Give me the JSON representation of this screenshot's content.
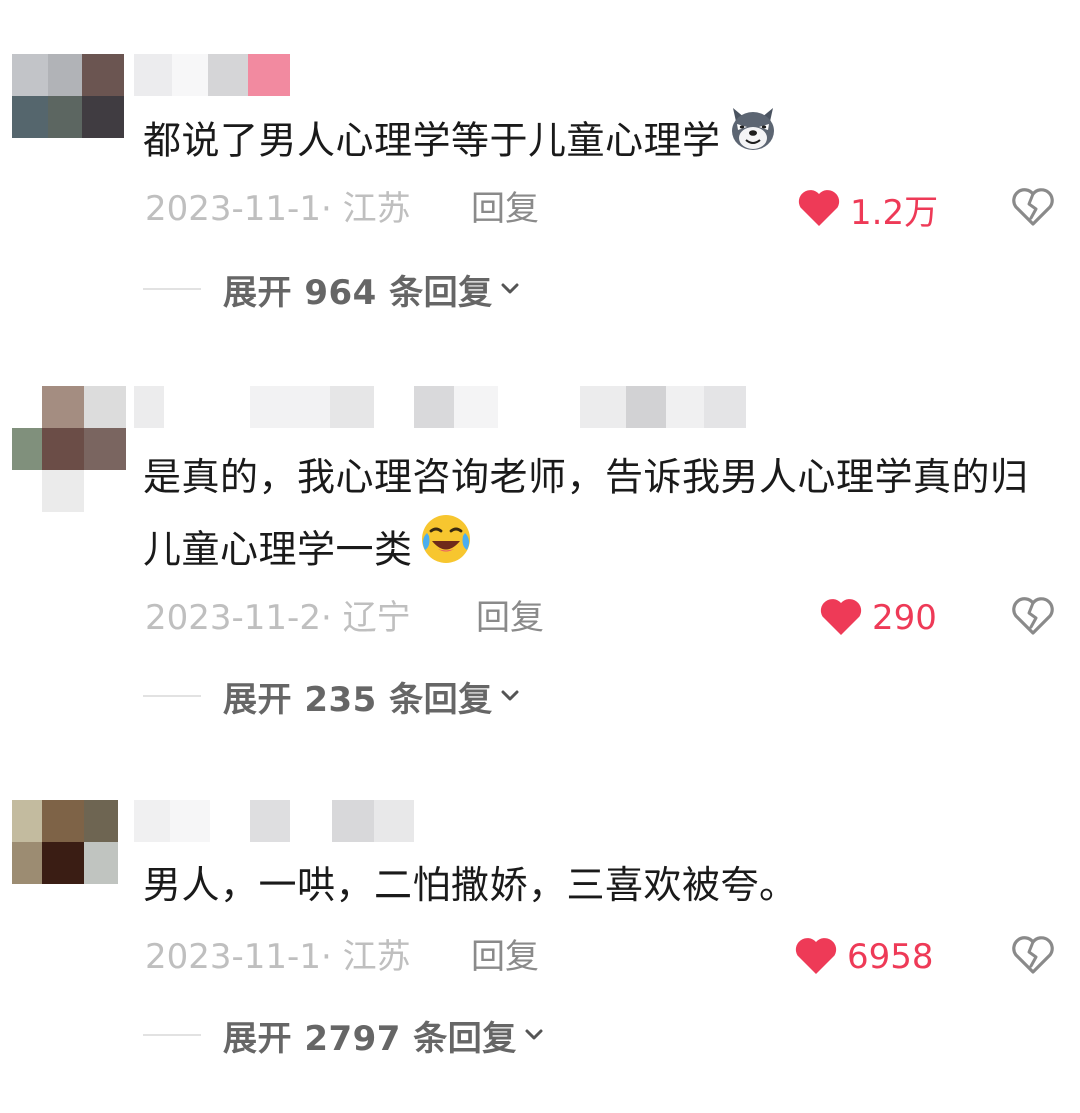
{
  "colors": {
    "heart": "#ee3a57",
    "like_count": "#ee3a57",
    "meta_text": "#bfbfbf",
    "reply_text": "#8a8a8a",
    "expand_text": "#666666"
  },
  "comments": [
    {
      "text": "都说了男人心理学等于儿童心理学",
      "emoji": "husky-dog-emoji",
      "date_location": "2023-11-1· 江苏",
      "reply_label": "回复",
      "likes": "1.2万",
      "expand_label": "展开 964 条回复"
    },
    {
      "text": "是真的，我心理咨询老师，告诉我男人心理学真的归儿童心理学一类",
      "emoji": "laugh-cry-emoji",
      "date_location": "2023-11-2· 辽宁",
      "reply_label": "回复",
      "likes": "290",
      "expand_label": "展开 235 条回复"
    },
    {
      "text": "男人，一哄，二怕撒娇，三喜欢被夸。",
      "date_location": "2023-11-1· 江苏",
      "reply_label": "回复",
      "likes": "6958",
      "expand_label": "展开 2797 条回复"
    }
  ]
}
